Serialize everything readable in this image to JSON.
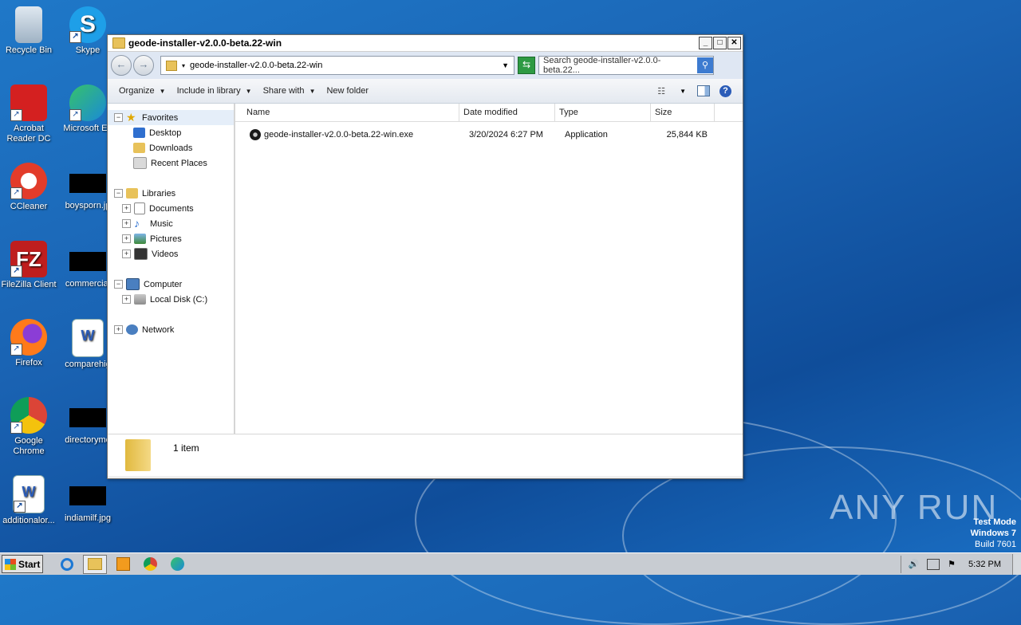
{
  "desktop": {
    "icons": [
      {
        "label": "Recycle Bin"
      },
      {
        "label": "Skype"
      },
      {
        "label": "Acrobat Reader DC"
      },
      {
        "label": "Microsoft Ed"
      },
      {
        "label": "CCleaner"
      },
      {
        "label": "boysporn.jp"
      },
      {
        "label": "FileZilla Client"
      },
      {
        "label": "commercial"
      },
      {
        "label": "Firefox"
      },
      {
        "label": "comparehig"
      },
      {
        "label": "Google Chrome"
      },
      {
        "label": "directoryme"
      },
      {
        "label": "additionalor..."
      },
      {
        "label": "indiamilf.jpg"
      }
    ]
  },
  "window": {
    "title": "geode-installer-v2.0.0-beta.22-win",
    "address": "geode-installer-v2.0.0-beta.22-win",
    "search_placeholder": "Search geode-installer-v2.0.0-beta.22...",
    "toolbar": {
      "organize": "Organize",
      "include": "Include in library",
      "share": "Share with",
      "new_folder": "New folder"
    },
    "nav": {
      "favorites": "Favorites",
      "desktop": "Desktop",
      "downloads": "Downloads",
      "recent": "Recent Places",
      "libraries": "Libraries",
      "documents": "Documents",
      "music": "Music",
      "pictures": "Pictures",
      "videos": "Videos",
      "computer": "Computer",
      "local_disk": "Local Disk (C:)",
      "network": "Network"
    },
    "columns": {
      "name": "Name",
      "date": "Date modified",
      "type": "Type",
      "size": "Size"
    },
    "files": [
      {
        "name": "geode-installer-v2.0.0-beta.22-win.exe",
        "date": "3/20/2024 6:27 PM",
        "type": "Application",
        "size": "25,844 KB"
      }
    ],
    "status": "1 item"
  },
  "watermark": {
    "brand": "ANY RUN",
    "test_mode": "Test Mode",
    "os": "Windows 7",
    "build": "Build 7601"
  },
  "taskbar": {
    "start": "Start",
    "clock": "5:32 PM"
  }
}
